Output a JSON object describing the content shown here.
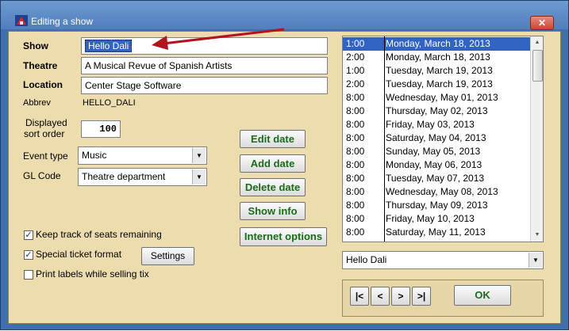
{
  "window": {
    "title": "Editing a show",
    "close_label": "✕"
  },
  "form": {
    "show_label": "Show",
    "show_value": "Hello Dali",
    "theatre_label": "Theatre",
    "theatre_value": "A Musical Revue  of Spanish Artists",
    "location_label": "Location",
    "location_value": "Center Stage Software",
    "abbrev_label": "Abbrev",
    "abbrev_value": "HELLO_DALI",
    "sort_order_label_1": "Displayed",
    "sort_order_label_2": "sort order",
    "sort_order_value": "100",
    "event_type_label": "Event type",
    "event_type_value": "Music",
    "gl_code_label": "GL Code",
    "gl_code_value": "Theatre department"
  },
  "options": {
    "keep_track_label": "Keep track of seats remaining",
    "keep_track_checked": true,
    "special_ticket_label": "Special ticket format",
    "special_ticket_checked": true,
    "settings_label": "Settings",
    "print_labels_label": "Print labels while selling tix",
    "print_labels_checked": false
  },
  "actions": {
    "edit_date": "Edit date",
    "add_date": "Add date",
    "delete_date": "Delete date",
    "show_info": "Show info",
    "internet_options": "Internet options"
  },
  "dates": [
    {
      "time": "1:00",
      "date": "Monday, March 18, 2013",
      "selected": true
    },
    {
      "time": "2:00",
      "date": "Monday, March 18, 2013"
    },
    {
      "time": "1:00",
      "date": "Tuesday, March 19, 2013"
    },
    {
      "time": "2:00",
      "date": "Tuesday, March 19, 2013"
    },
    {
      "time": "8:00",
      "date": "Wednesday, May 01, 2013"
    },
    {
      "time": "8:00",
      "date": "Thursday, May 02, 2013"
    },
    {
      "time": "8:00",
      "date": "Friday, May 03, 2013"
    },
    {
      "time": "8:00",
      "date": "Saturday, May 04, 2013"
    },
    {
      "time": "8:00",
      "date": "Sunday, May 05, 2013"
    },
    {
      "time": "8:00",
      "date": "Monday, May 06, 2013"
    },
    {
      "time": "8:00",
      "date": "Tuesday, May 07, 2013"
    },
    {
      "time": "8:00",
      "date": "Wednesday, May 08, 2013"
    },
    {
      "time": "8:00",
      "date": "Thursday, May 09, 2013"
    },
    {
      "time": "8:00",
      "date": "Friday, May 10, 2013"
    },
    {
      "time": "8:00",
      "date": "Saturday, May 11, 2013"
    }
  ],
  "show_select_value": "Hello Dali",
  "nav": {
    "first": "|<",
    "prev": "<",
    "next": ">",
    "last": ">|",
    "ok": "OK"
  },
  "colors": {
    "selection": "#3163c5",
    "panel": "#ecdcae",
    "button_text": "#1a6b1a",
    "annotation_arrow": "#b0141c"
  },
  "icons": {
    "app": "theatre-app-icon",
    "close": "close-icon",
    "dropdown": "chevron-down-icon",
    "check": "checkmark-icon"
  }
}
